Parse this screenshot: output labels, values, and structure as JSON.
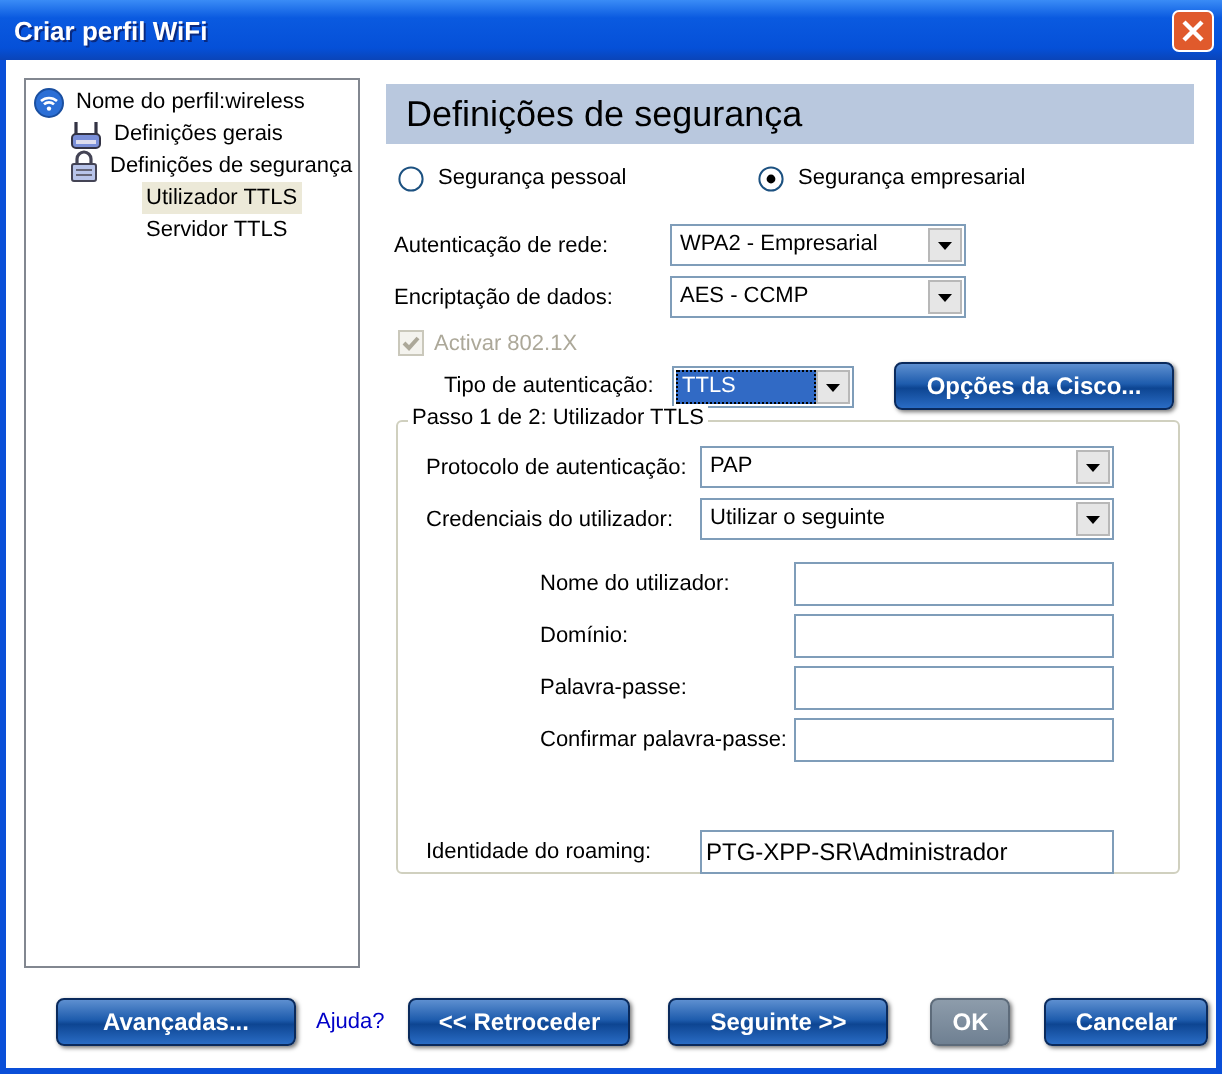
{
  "window": {
    "title": "Criar perfil WiFi"
  },
  "tree": [
    {
      "label": "Nome do perfil:wireless",
      "kind": "wifi",
      "selected": false,
      "children": [
        {
          "label": "Definições gerais",
          "kind": "router",
          "selected": false
        },
        {
          "label": "Definições de segurança",
          "kind": "lock",
          "selected": false,
          "children": [
            {
              "label": "Utilizador TTLS",
              "kind": "plain",
              "selected": true
            },
            {
              "label": "Servidor TTLS",
              "kind": "plain",
              "selected": false
            }
          ]
        }
      ]
    }
  ],
  "panel": {
    "heading": "Definições de segurança",
    "security_modes": [
      {
        "label": "Segurança pessoal",
        "selected": false
      },
      {
        "label": "Segurança empresarial",
        "selected": true
      }
    ],
    "network_auth": {
      "label": "Autenticação de rede:",
      "value": "WPA2 - Empresarial"
    },
    "data_encryption": {
      "label": "Encriptação de dados:",
      "value": "AES - CCMP"
    },
    "enable_8021x": {
      "label": "Activar 802.1X",
      "checked": true,
      "disabled": true
    },
    "auth_type": {
      "label": "Tipo de autenticação:",
      "value": "TTLS",
      "focused": true
    },
    "cisco_button": "Opções da Cisco...",
    "step": {
      "title": "Passo 1 de 2: Utilizador TTLS",
      "auth_protocol": {
        "label": "Protocolo de autenticação:",
        "value": "PAP"
      },
      "credentials": {
        "label": "Credenciais do utilizador:",
        "value": "Utilizar o seguinte"
      },
      "fields": [
        {
          "label": "Nome do utilizador:"
        },
        {
          "label": "Domínio:"
        },
        {
          "label": "Palavra-passe:"
        },
        {
          "label": "Confirmar palavra-passe:"
        }
      ],
      "roaming": {
        "label": "Identidade do roaming:",
        "value": "PTG-XPP-SR\\Administrador"
      }
    }
  },
  "footer": [
    {
      "kind": "button",
      "label": "Avançadas...",
      "disabled": false
    },
    {
      "kind": "link",
      "label": "Ajuda?"
    },
    {
      "kind": "button",
      "label": "<< Retroceder",
      "disabled": false
    },
    {
      "kind": "button",
      "label": "Seguinte >>",
      "disabled": false
    },
    {
      "kind": "button",
      "label": "OK",
      "disabled": true
    },
    {
      "kind": "button",
      "label": "Cancelar",
      "disabled": false
    }
  ]
}
